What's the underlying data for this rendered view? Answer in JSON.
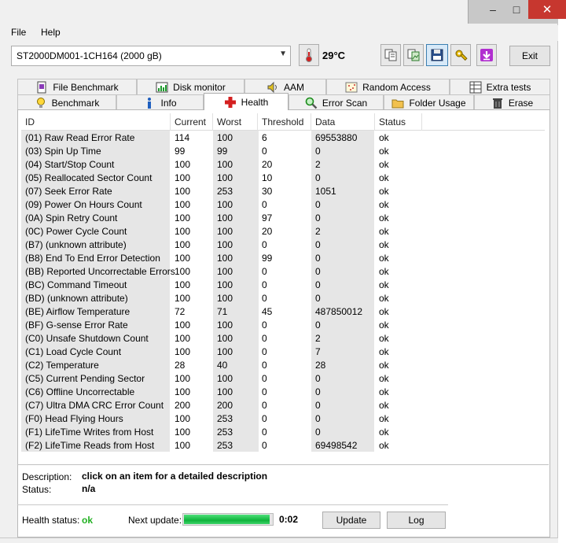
{
  "window": {
    "minimize_glyph": "–",
    "maximize_glyph": "□",
    "close_glyph": "✕"
  },
  "menu": {
    "file": "File",
    "help": "Help"
  },
  "toolbar": {
    "drive": "ST2000DM001-1CH164 (2000 gB)",
    "temperature": "29°C",
    "exit_label": "Exit"
  },
  "tabs_top": [
    {
      "label": "File Benchmark",
      "icon": "file-benchmark-icon"
    },
    {
      "label": "Disk monitor",
      "icon": "disk-monitor-icon"
    },
    {
      "label": "AAM",
      "icon": "speaker-icon"
    },
    {
      "label": "Random Access",
      "icon": "random-access-icon"
    },
    {
      "label": "Extra tests",
      "icon": "extra-tests-icon"
    }
  ],
  "tabs_bottom": [
    {
      "label": "Benchmark",
      "icon": "lightbulb-icon"
    },
    {
      "label": "Info",
      "icon": "info-icon"
    },
    {
      "label": "Health",
      "icon": "health-cross-icon",
      "active": true
    },
    {
      "label": "Error Scan",
      "icon": "magnifier-icon"
    },
    {
      "label": "Folder Usage",
      "icon": "folder-icon"
    },
    {
      "label": "Erase",
      "icon": "trash-icon"
    }
  ],
  "table": {
    "headers": [
      "ID",
      "Current",
      "Worst",
      "Threshold",
      "Data",
      "Status"
    ],
    "rows": [
      [
        "(01) Raw Read Error Rate",
        "114",
        "100",
        "6",
        "69553880",
        "ok"
      ],
      [
        "(03) Spin Up Time",
        "99",
        "99",
        "0",
        "0",
        "ok"
      ],
      [
        "(04) Start/Stop Count",
        "100",
        "100",
        "20",
        "2",
        "ok"
      ],
      [
        "(05) Reallocated Sector Count",
        "100",
        "100",
        "10",
        "0",
        "ok"
      ],
      [
        "(07) Seek Error Rate",
        "100",
        "253",
        "30",
        "1051",
        "ok"
      ],
      [
        "(09) Power On Hours Count",
        "100",
        "100",
        "0",
        "0",
        "ok"
      ],
      [
        "(0A) Spin Retry Count",
        "100",
        "100",
        "97",
        "0",
        "ok"
      ],
      [
        "(0C) Power Cycle Count",
        "100",
        "100",
        "20",
        "2",
        "ok"
      ],
      [
        "(B7) (unknown attribute)",
        "100",
        "100",
        "0",
        "0",
        "ok"
      ],
      [
        "(B8) End To End Error Detection",
        "100",
        "100",
        "99",
        "0",
        "ok"
      ],
      [
        "(BB) Reported Uncorrectable Errors",
        "100",
        "100",
        "0",
        "0",
        "ok"
      ],
      [
        "(BC) Command Timeout",
        "100",
        "100",
        "0",
        "0",
        "ok"
      ],
      [
        "(BD) (unknown attribute)",
        "100",
        "100",
        "0",
        "0",
        "ok"
      ],
      [
        "(BE) Airflow Temperature",
        "72",
        "71",
        "45",
        "487850012",
        "ok"
      ],
      [
        "(BF) G-sense Error Rate",
        "100",
        "100",
        "0",
        "0",
        "ok"
      ],
      [
        "(C0) Unsafe Shutdown Count",
        "100",
        "100",
        "0",
        "2",
        "ok"
      ],
      [
        "(C1) Load Cycle Count",
        "100",
        "100",
        "0",
        "7",
        "ok"
      ],
      [
        "(C2) Temperature",
        "28",
        "40",
        "0",
        "28",
        "ok"
      ],
      [
        "(C5) Current Pending Sector",
        "100",
        "100",
        "0",
        "0",
        "ok"
      ],
      [
        "(C6) Offline Uncorrectable",
        "100",
        "100",
        "0",
        "0",
        "ok"
      ],
      [
        "(C7) Ultra DMA CRC Error Count",
        "200",
        "200",
        "0",
        "0",
        "ok"
      ],
      [
        "(F0) Head Flying Hours",
        "100",
        "253",
        "0",
        "0",
        "ok"
      ],
      [
        "(F1) LifeTime Writes from Host",
        "100",
        "253",
        "0",
        "0",
        "ok"
      ],
      [
        "(F2) LifeTime Reads from Host",
        "100",
        "253",
        "0",
        "69498542",
        "ok"
      ]
    ]
  },
  "description": {
    "label": "Description:",
    "value": "click on an item for a detailed description",
    "status_label": "Status:",
    "status_value": "n/a"
  },
  "footer": {
    "health_label": "Health status:",
    "health_value": "ok",
    "next_update_label": "Next update:",
    "progress_fraction": 0.97,
    "countdown": "0:02",
    "update_label": "Update",
    "log_label": "Log"
  },
  "colors": {
    "health_ok": "#21b021",
    "progress_green": "#0fb33b"
  }
}
